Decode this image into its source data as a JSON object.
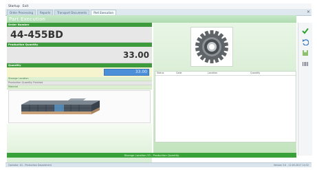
{
  "menu": {
    "items": [
      "Startup",
      "Exit"
    ]
  },
  "tabs": [
    {
      "label": "Order Processing",
      "active": false
    },
    {
      "label": "Reports",
      "active": false
    },
    {
      "label": "Transport Documents",
      "active": false
    },
    {
      "label": "Part Execution",
      "active": true
    }
  ],
  "header": {
    "title": "Part Execution"
  },
  "form": {
    "order_label": "Order Number",
    "order_value": "44-455BD",
    "qty_label": "Production Quantity",
    "qty_value": "33.00",
    "quantity_label": "Quantity",
    "quantity_input": "33.00",
    "row1": "Storage Location",
    "row2": "Production Quantity Finished",
    "row3": "Material"
  },
  "table": {
    "columns": [
      "Status",
      "Code",
      "Location",
      "Quantity"
    ]
  },
  "status": {
    "text": "Storage Location 33 - Production Quantity"
  },
  "footer": {
    "left": "Operator: 01 - Production Department",
    "right": "Version 3.0 - 12.05.2017 14:32"
  },
  "colors": {
    "accent": "#3d9a3d",
    "input": "#4a8fd8",
    "highlight": "#f5f4cf"
  },
  "icons": [
    "checkmark-icon",
    "undo-icon",
    "save-icon",
    "barcode-icon",
    "gear-image"
  ]
}
